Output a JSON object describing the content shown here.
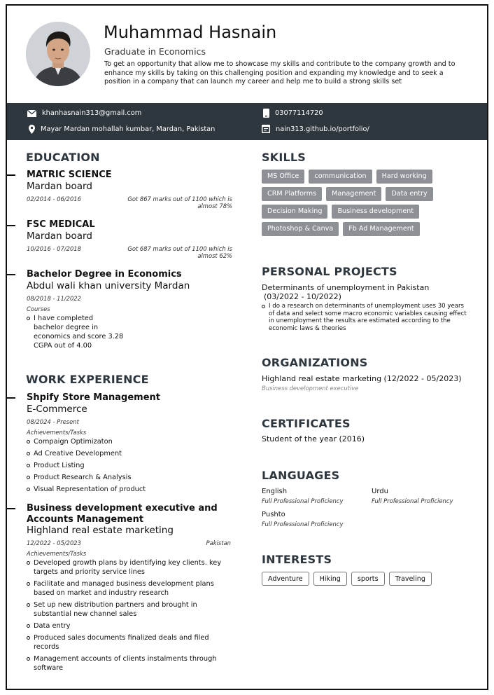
{
  "header": {
    "name": "Muhammad Hasnain",
    "subtitle": "Graduate in Economics",
    "summary": "To get an opportunity that allow me to showcase my skills and contribute to the company growth and to enhance my skills by taking on this challenging position and expanding my knowledge and to seek a position in a company that can launch my career and help me to build a strong skills set"
  },
  "contact": {
    "email": "khanhasnain313@gmail.com",
    "phone": "03077114720",
    "address": "Mayar Mardan mohallah kumbar, Mardan, Pakistan",
    "website": "nain313.github.io/portfolio/"
  },
  "education": {
    "title": "EDUCATION",
    "items": [
      {
        "degree": "MATRIC SCIENCE",
        "institution": "Mardan board",
        "dates": "02/2014 - 06/2016",
        "note": "Got 867 marks out of 1100 which is almost 78%"
      },
      {
        "degree": "FSC MEDICAL",
        "institution": "Mardan board",
        "dates": "10/2016 - 07/2018",
        "note": "Got 687 marks out of 1100 which is almost 62%"
      },
      {
        "degree": "Bachelor Degree in Economics",
        "institution": "Abdul wali khan university Mardan",
        "dates": "08/2018 - 11/2022",
        "courses_label": "Courses",
        "bullets": [
          "I have completed bachelor degree in economics and score 3.28 CGPA out of 4.00"
        ]
      }
    ]
  },
  "work": {
    "title": "WORK EXPERIENCE",
    "items": [
      {
        "role": "Shpify Store Management",
        "company": "E-Commerce",
        "dates": "08/2024 - Present",
        "label": "Achievements/Tasks",
        "bullets": [
          "Compaign Optimizaton",
          "Ad Creative Development",
          "Product Listing",
          "Product Research & Analysis",
          "Visual Representation of product"
        ]
      },
      {
        "role_line1": "Business development executive and",
        "role_line2": "Accounts Management",
        "company": "Highland real estate marketing",
        "dates": "12/2022 - 05/2023",
        "location": "Pakistan",
        "label": "Achievements/Tasks",
        "bullets": [
          "Developed growth plans by identifying key clients. key targets and priority service lines",
          "Facilitate and managed business development plans based on market and industry research",
          "Set up new distribution partners and brought in substantial new channel sales",
          "Data entry",
          "Produced sales documents finalized deals and filed records",
          "Management accounts of clients instalments through software"
        ]
      }
    ]
  },
  "skills": {
    "title": "SKILLS",
    "items": [
      "MS Office",
      "communication",
      "Hard working",
      "CRM Platforms",
      "Management",
      "Data entry",
      "Decision Making",
      "Business development",
      "Photoshop & Canva",
      "Fb Ad Management"
    ]
  },
  "projects": {
    "title": "PERSONAL PROJECTS",
    "name": "Determinants of unemployment in Pakistan",
    "dates": "(03/2022 - 10/2022)",
    "bullets": [
      "I do a research on determinants of unemployment uses 30 years of data and select some macro economic variables causing effect in unemployment the results are estimated according to the economic laws & theories"
    ]
  },
  "organizations": {
    "title": "ORGANIZATIONS",
    "name": "Highland real estate marketing (12/2022 - 05/2023)",
    "role": "Business development executive"
  },
  "certificates": {
    "title": "CERTIFICATES",
    "item": "Student of the year (2016)"
  },
  "languages": {
    "title": "LANGUAGES",
    "items": [
      {
        "name": "English",
        "level": "Full Professional Proficiency"
      },
      {
        "name": "Urdu",
        "level": "Full Professional Proficiency"
      },
      {
        "name": "Pushto",
        "level": "Full Professional Proficiency"
      }
    ]
  },
  "interests": {
    "title": "INTERESTS",
    "items": [
      "Adventure",
      "Hiking",
      "sports",
      "Traveling"
    ]
  },
  "colors": {
    "bar": "#2e363e",
    "chip": "#8d9095"
  }
}
